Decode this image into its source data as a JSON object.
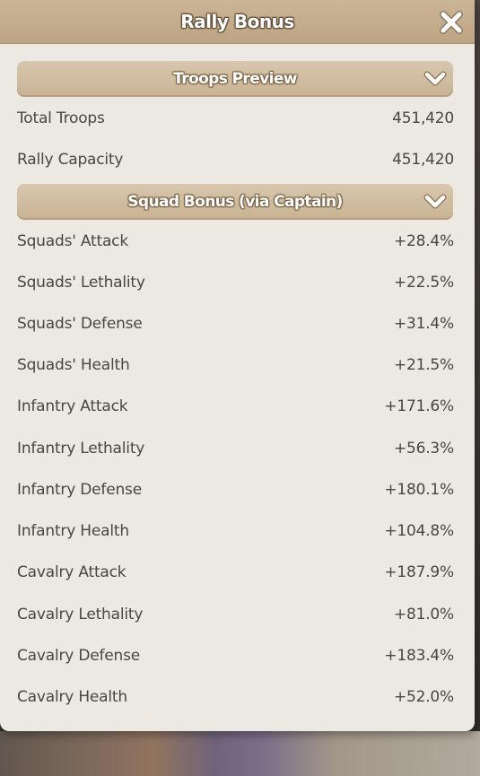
{
  "dialog": {
    "title": "Rally Bonus"
  },
  "troops_preview": {
    "header": "Troops Preview",
    "rows": [
      {
        "label": "Total Troops",
        "value": "451,420"
      },
      {
        "label": "Rally Capacity",
        "value": "451,420"
      }
    ]
  },
  "squad_bonus": {
    "header": "Squad Bonus (via Captain)",
    "rows": [
      {
        "label": "Squads' Attack",
        "value": "+28.4%"
      },
      {
        "label": "Squads' Lethality",
        "value": "+22.5%"
      },
      {
        "label": "Squads' Defense",
        "value": "+31.4%"
      },
      {
        "label": "Squads' Health",
        "value": "+21.5%"
      },
      {
        "label": "Infantry Attack",
        "value": "+171.6%"
      },
      {
        "label": "Infantry Lethality",
        "value": "+56.3%"
      },
      {
        "label": "Infantry Defense",
        "value": "+180.1%"
      },
      {
        "label": "Infantry Health",
        "value": "+104.8%"
      },
      {
        "label": "Cavalry Attack",
        "value": "+187.9%"
      },
      {
        "label": "Cavalry Lethality",
        "value": "+81.0%"
      },
      {
        "label": "Cavalry Defense",
        "value": "+183.4%"
      },
      {
        "label": "Cavalry Health",
        "value": "+52.0%"
      }
    ]
  },
  "icons": {
    "close": "close-icon",
    "collapse": "chevron-down-icon"
  }
}
